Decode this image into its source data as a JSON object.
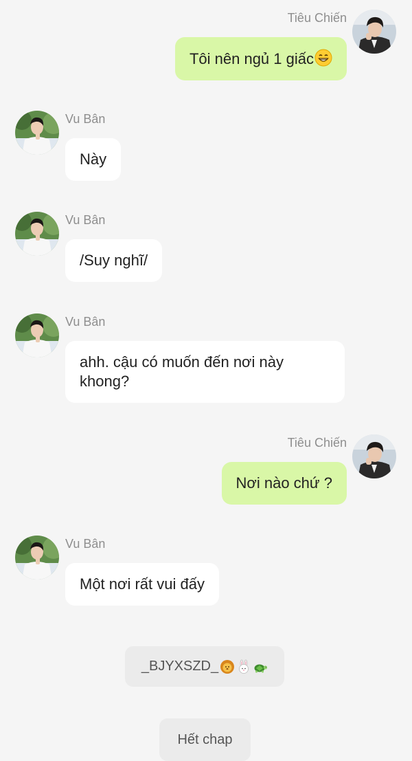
{
  "participants": {
    "right_name": "Tiêu Chiến",
    "left_name": "Vu Bân"
  },
  "messages": [
    {
      "side": "right",
      "sender": "Tiêu Chiến",
      "text": "Tôi nên ngủ 1 giấc",
      "emoji": "grinning-face-icon"
    },
    {
      "side": "left",
      "sender": "Vu Bân",
      "text": "Này"
    },
    {
      "side": "left",
      "sender": "Vu Bân",
      "text": "/Suy nghĩ/"
    },
    {
      "side": "left",
      "sender": "Vu Bân",
      "text": "ahh. cậu có muốn đến nơi này khong?"
    },
    {
      "side": "right",
      "sender": "Tiêu Chiến",
      "text": "Nơi nào chứ ?"
    },
    {
      "side": "left",
      "sender": "Vu Bân",
      "text": "Một nơi rất vui đấy"
    }
  ],
  "footer": {
    "signature": "_BJYXSZD_",
    "signature_emojis": [
      "lion-icon",
      "rabbit-icon",
      "turtle-icon"
    ],
    "end_label": "Hết chap"
  },
  "colors": {
    "background": "#f5f5f5",
    "right_bubble": "#d9f7a7",
    "left_bubble": "#ffffff",
    "chip": "#ebebeb"
  }
}
